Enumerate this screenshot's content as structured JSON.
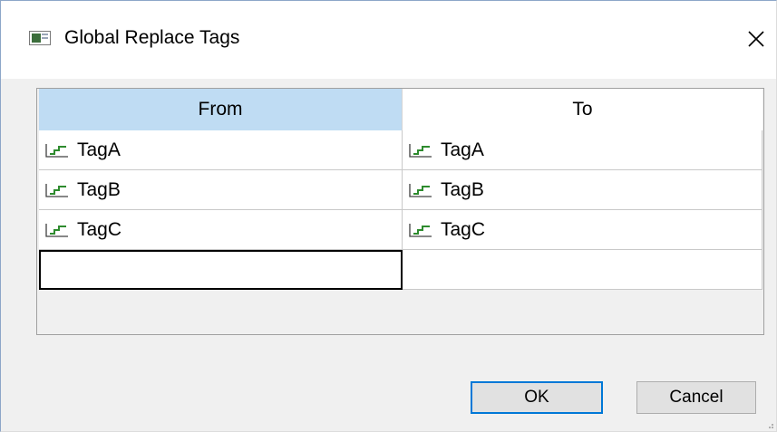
{
  "window": {
    "title": "Global Replace Tags",
    "icon": "app-window-icon",
    "close_icon": "close-icon"
  },
  "grid": {
    "columns": [
      "From",
      "To"
    ],
    "rows": [
      {
        "from": "TagA",
        "to": "TagA"
      },
      {
        "from": "TagB",
        "to": "TagB"
      },
      {
        "from": "TagC",
        "to": "TagC"
      },
      {
        "from": "",
        "to": ""
      }
    ],
    "row_icon": "tag-step-icon",
    "header_selected_color": "#bfdcf3",
    "icon_color": "#2e8b2e"
  },
  "buttons": {
    "ok": "OK",
    "cancel": "Cancel",
    "default_accent": "#0078d7"
  }
}
